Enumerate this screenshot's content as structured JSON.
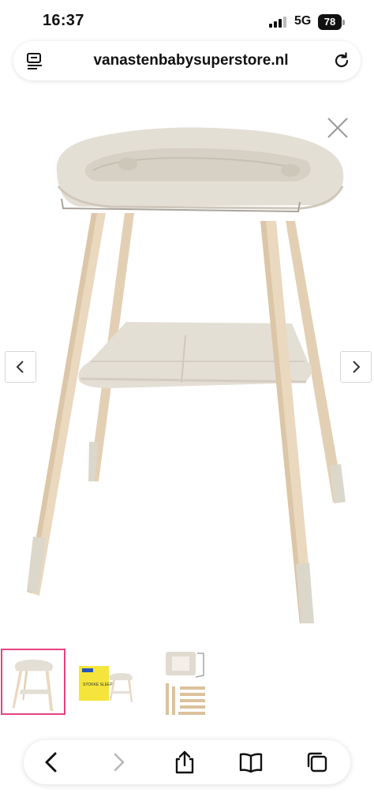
{
  "status_bar": {
    "time": "16:37",
    "network": "5G",
    "battery": "78"
  },
  "browser": {
    "url": "vanastenbabysuperstore.nl"
  },
  "gallery": {
    "image_alt": "Changing table with wooden legs",
    "thumbnails": [
      {
        "name": "changing-table-front",
        "selected": true
      },
      {
        "name": "changing-table-with-box",
        "selected": false
      },
      {
        "name": "changing-table-parts",
        "selected": false
      }
    ],
    "box_label": "STOKKE SLEEP"
  },
  "toolbar": {
    "icons": [
      "back-icon",
      "forward-icon",
      "share-icon",
      "bookmarks-icon",
      "tabs-icon"
    ]
  },
  "colors": {
    "tray": "#e4dfd5",
    "tray_shadow": "#cfc8bb",
    "wood": "#ead8bf",
    "wood_dark": "#d9c2a3",
    "leg_tip": "#dcd7cb",
    "selected_thumb": "#e6417f",
    "disabled_icon": "#b8b8b8"
  }
}
